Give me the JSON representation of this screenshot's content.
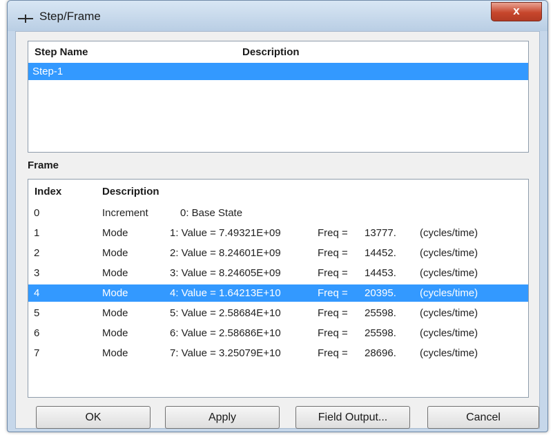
{
  "window": {
    "title": "Step/Frame",
    "close_label": "x"
  },
  "steps": {
    "headers": {
      "name": "Step Name",
      "description": "Description"
    },
    "rows": [
      {
        "name": "Step-1",
        "description": "",
        "selected": true
      }
    ]
  },
  "frame": {
    "label": "Frame",
    "headers": {
      "index": "Index",
      "description": "Description"
    },
    "rows": [
      {
        "index": "0",
        "type": "Increment",
        "desc": "0: Base State",
        "freq_label": "",
        "freq": "",
        "units": "",
        "selected": false
      },
      {
        "index": "1",
        "type": "Mode",
        "desc": "1: Value = 7.49321E+09",
        "freq_label": "Freq =",
        "freq": "13777.",
        "units": "(cycles/time)",
        "selected": false
      },
      {
        "index": "2",
        "type": "Mode",
        "desc": "2: Value = 8.24601E+09",
        "freq_label": "Freq =",
        "freq": "14452.",
        "units": "(cycles/time)",
        "selected": false
      },
      {
        "index": "3",
        "type": "Mode",
        "desc": "3: Value = 8.24605E+09",
        "freq_label": "Freq =",
        "freq": "14453.",
        "units": "(cycles/time)",
        "selected": false
      },
      {
        "index": "4",
        "type": "Mode",
        "desc": "4: Value = 1.64213E+10",
        "freq_label": "Freq =",
        "freq": "20395.",
        "units": "(cycles/time)",
        "selected": true
      },
      {
        "index": "5",
        "type": "Mode",
        "desc": "5: Value = 2.58684E+10",
        "freq_label": "Freq =",
        "freq": "25598.",
        "units": "(cycles/time)",
        "selected": false
      },
      {
        "index": "6",
        "type": "Mode",
        "desc": "6: Value = 2.58686E+10",
        "freq_label": "Freq =",
        "freq": "25598.",
        "units": "(cycles/time)",
        "selected": false
      },
      {
        "index": "7",
        "type": "Mode",
        "desc": "7: Value = 3.25079E+10",
        "freq_label": "Freq =",
        "freq": "28696.",
        "units": "(cycles/time)",
        "selected": false
      }
    ]
  },
  "buttons": {
    "ok": "OK",
    "apply": "Apply",
    "field_output": "Field Output...",
    "cancel": "Cancel"
  }
}
